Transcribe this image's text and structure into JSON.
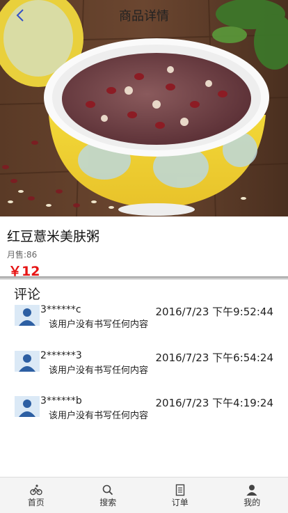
{
  "header": {
    "title": "商品详情"
  },
  "product": {
    "name": "红豆薏米美肤粥",
    "monthly_sales": "月售:86",
    "price": "￥12"
  },
  "comments": {
    "title": "评论",
    "items": [
      {
        "user": "3******c",
        "time": "2016/7/23 下午9:52:44",
        "text": "该用户没有书写任何内容"
      },
      {
        "user": "2******3",
        "time": "2016/7/23 下午6:54:24",
        "text": "该用户没有书写任何内容"
      },
      {
        "user": "3******b",
        "time": "2016/7/23 下午4:19:24",
        "text": "该用户没有书写任何内容"
      }
    ]
  },
  "tabbar": {
    "tabs": [
      {
        "label": "首页",
        "icon": "bike-icon"
      },
      {
        "label": "搜索",
        "icon": "search-icon"
      },
      {
        "label": "订单",
        "icon": "order-icon"
      },
      {
        "label": "我的",
        "icon": "user-icon"
      }
    ]
  },
  "colors": {
    "price": "#e61414",
    "tabbar_bg": "#f4f4f4"
  }
}
